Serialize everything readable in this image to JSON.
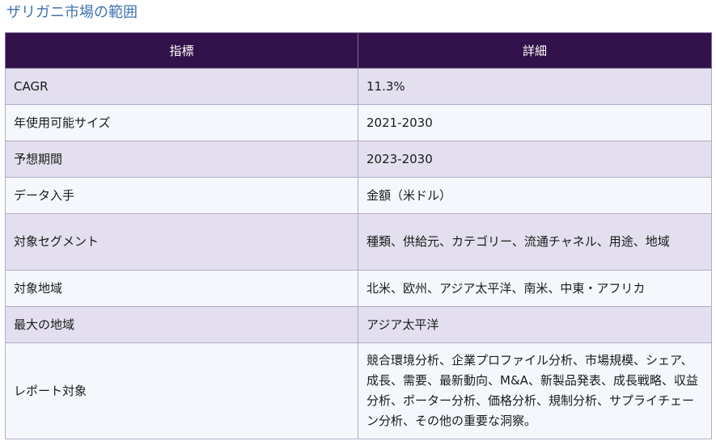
{
  "title": "ザリガニ市場の範囲",
  "table": {
    "headers": [
      "指標",
      "詳細"
    ],
    "rows": [
      {
        "label": "CAGR",
        "value": "11.3%"
      },
      {
        "label": "年使用可能サイズ",
        "value": "2021-2030"
      },
      {
        "label": "予想期間",
        "value": "2023-2030"
      },
      {
        "label": "データ入手",
        "value": "金額（米ドル）"
      },
      {
        "label": "対象セグメント",
        "value": "種類、供給元、カテゴリー、流通チャネル、用途、地域"
      },
      {
        "label": "対象地域",
        "value": "北米、欧州、アジア太平洋、南米、中東・アフリカ"
      },
      {
        "label": "最大の地域",
        "value": "アジア太平洋"
      },
      {
        "label": "レポート対象",
        "value": "競合環境分析、企業プロファイル分析、市場規模、シェア、成長、需要、最新動向、M&A、新製品発表、成長戦略、収益分析、ポーター分析、価格分析、規制分析、サプライチェーン分析、その他の重要な洞察。"
      }
    ]
  }
}
